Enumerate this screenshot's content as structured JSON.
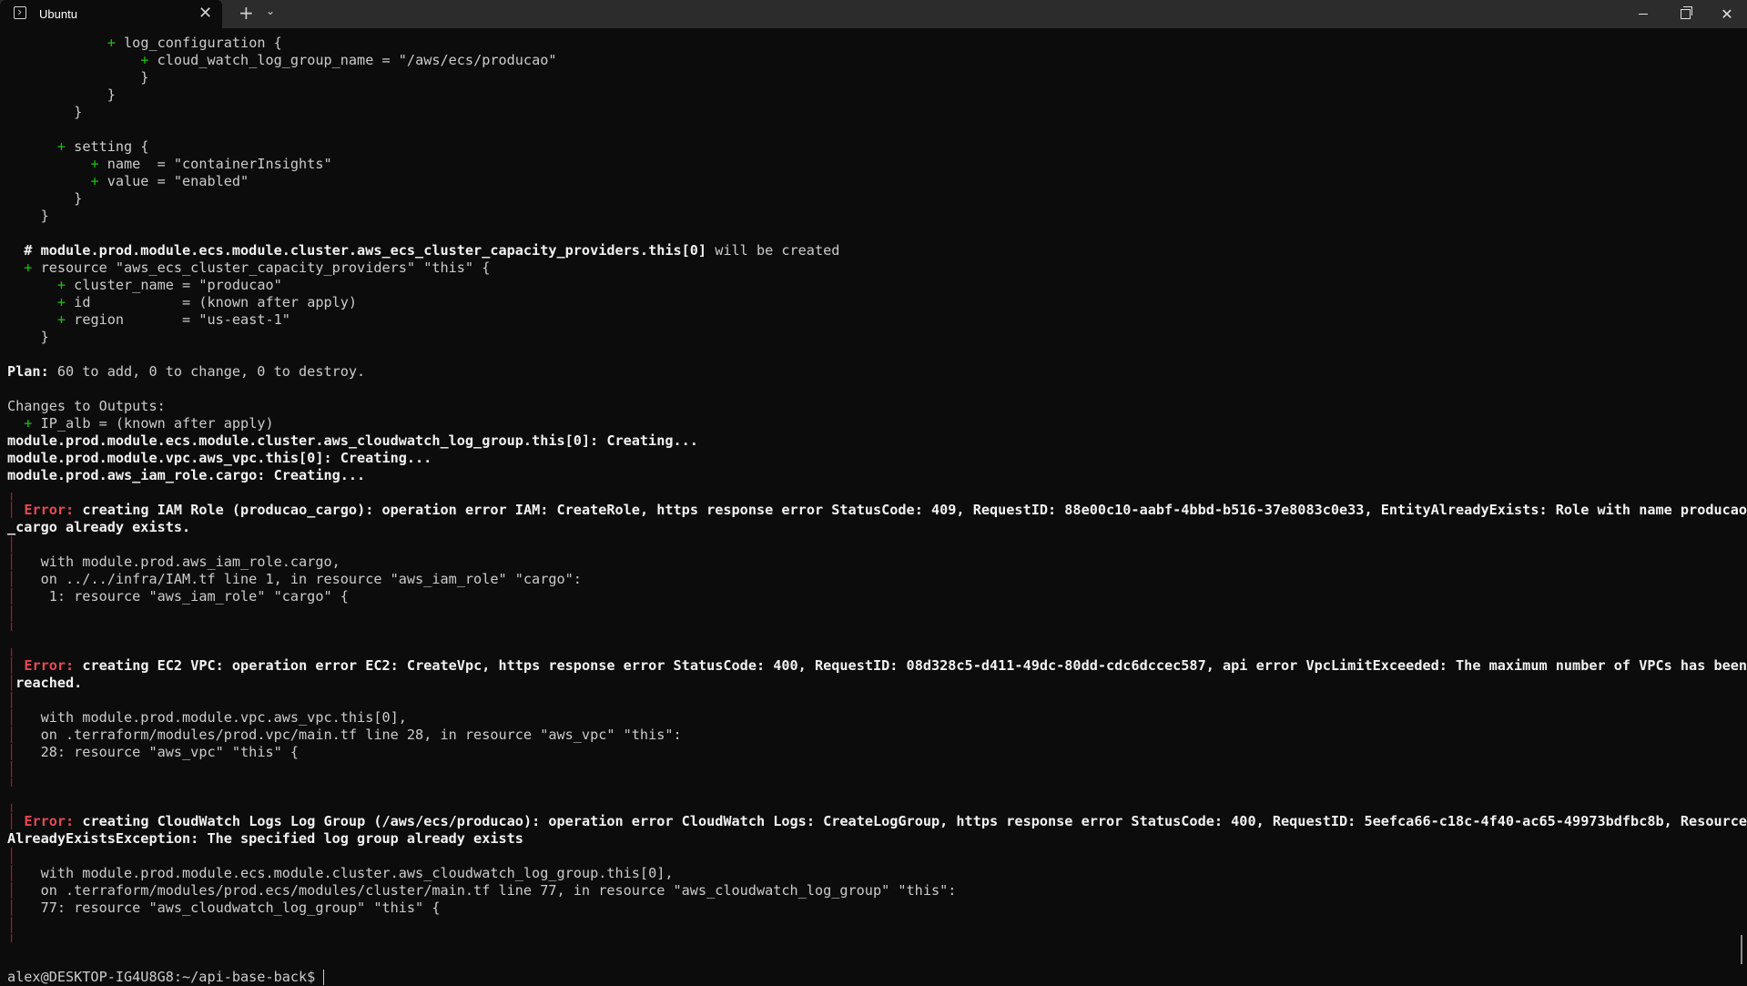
{
  "window": {
    "tab_title": "Ubuntu",
    "tab_close": "✕",
    "new_tab": "+",
    "dropdown": "⌄",
    "close": "✕"
  },
  "terminal": {
    "lines": [
      {
        "segments": [
          {
            "t": "            "
          },
          {
            "t": "+",
            "c": "plus"
          },
          {
            "t": " log_configuration {"
          }
        ]
      },
      {
        "segments": [
          {
            "t": "                "
          },
          {
            "t": "+",
            "c": "plus"
          },
          {
            "t": " cloud_watch_log_group_name = \"/aws/ecs/producao\""
          }
        ]
      },
      {
        "segments": [
          {
            "t": "                }"
          }
        ]
      },
      {
        "segments": [
          {
            "t": "            }"
          }
        ]
      },
      {
        "segments": [
          {
            "t": "        }"
          }
        ]
      },
      {
        "segments": [
          {
            "t": ""
          }
        ]
      },
      {
        "segments": [
          {
            "t": "      "
          },
          {
            "t": "+",
            "c": "plus"
          },
          {
            "t": " setting {"
          }
        ]
      },
      {
        "segments": [
          {
            "t": "          "
          },
          {
            "t": "+",
            "c": "plus"
          },
          {
            "t": " name  = \"containerInsights\""
          }
        ]
      },
      {
        "segments": [
          {
            "t": "          "
          },
          {
            "t": "+",
            "c": "plus"
          },
          {
            "t": " value = \"enabled\""
          }
        ]
      },
      {
        "segments": [
          {
            "t": "        }"
          }
        ]
      },
      {
        "segments": [
          {
            "t": "    }"
          }
        ]
      },
      {
        "segments": [
          {
            "t": ""
          }
        ]
      },
      {
        "segments": [
          {
            "t": "  "
          },
          {
            "t": "# module.prod.module.ecs.module.cluster.aws_ecs_cluster_capacity_providers.this[0]",
            "c": "bold"
          },
          {
            "t": " will be created"
          }
        ]
      },
      {
        "segments": [
          {
            "t": "  "
          },
          {
            "t": "+",
            "c": "plus"
          },
          {
            "t": " resource \"aws_ecs_cluster_capacity_providers\" \"this\" {"
          }
        ]
      },
      {
        "segments": [
          {
            "t": "      "
          },
          {
            "t": "+",
            "c": "plus"
          },
          {
            "t": " cluster_name = \"producao\""
          }
        ]
      },
      {
        "segments": [
          {
            "t": "      "
          },
          {
            "t": "+",
            "c": "plus"
          },
          {
            "t": " id           = (known after apply)"
          }
        ]
      },
      {
        "segments": [
          {
            "t": "      "
          },
          {
            "t": "+",
            "c": "plus"
          },
          {
            "t": " region       = \"us-east-1\""
          }
        ]
      },
      {
        "segments": [
          {
            "t": "    }"
          }
        ]
      },
      {
        "segments": [
          {
            "t": ""
          }
        ]
      },
      {
        "segments": [
          {
            "t": "Plan:",
            "c": "bold"
          },
          {
            "t": " 60 to add, 0 to change, 0 to destroy."
          }
        ]
      },
      {
        "segments": [
          {
            "t": ""
          }
        ]
      },
      {
        "segments": [
          {
            "t": "Changes to Outputs:"
          }
        ]
      },
      {
        "segments": [
          {
            "t": "  "
          },
          {
            "t": "+",
            "c": "plus"
          },
          {
            "t": " IP_alb = (known after apply)"
          }
        ]
      },
      {
        "segments": [
          {
            "t": "module.prod.module.ecs.module.cluster.aws_cloudwatch_log_group.this[0]: Creating...",
            "c": "bold"
          }
        ]
      },
      {
        "segments": [
          {
            "t": "module.prod.module.vpc.aws_vpc.this[0]: Creating...",
            "c": "bold"
          }
        ]
      },
      {
        "segments": [
          {
            "t": "module.prod.aws_iam_role.cargo: Creating...",
            "c": "bold"
          }
        ]
      },
      {
        "segments": [
          {
            "t": "╷",
            "c": "err-bar"
          }
        ]
      },
      {
        "segments": [
          {
            "t": "│",
            "c": "err-bar"
          },
          {
            "t": " "
          },
          {
            "t": "Error:",
            "c": "err-label"
          },
          {
            "t": " creating IAM Role (producao_cargo): operation error IAM: CreateRole, https response error StatusCode: 409, RequestID: 88e00c10-aabf-4bbd-b516-37e8083c0e33, EntityAlreadyExists: Role with name producao",
            "c": "bold"
          }
        ]
      },
      {
        "segments": [
          {
            "t": "_cargo already exists.",
            "c": "bold"
          }
        ]
      },
      {
        "segments": [
          {
            "t": "│",
            "c": "err-bar"
          }
        ]
      },
      {
        "segments": [
          {
            "t": "│",
            "c": "err-bar"
          },
          {
            "t": "   with module.prod.aws_iam_role.cargo,"
          }
        ]
      },
      {
        "segments": [
          {
            "t": "│",
            "c": "err-bar"
          },
          {
            "t": "   on ../../infra/IAM.tf line 1, in resource \"aws_iam_role\" \"cargo\":"
          }
        ]
      },
      {
        "segments": [
          {
            "t": "│",
            "c": "err-bar"
          },
          {
            "t": "    1: resource \"aws_iam_role\" \"cargo\" {"
          }
        ]
      },
      {
        "segments": [
          {
            "t": "│",
            "c": "err-bar"
          }
        ]
      },
      {
        "segments": [
          {
            "t": "╵",
            "c": "err-bar"
          }
        ]
      },
      {
        "segments": [
          {
            "t": "╷",
            "c": "err-bar"
          }
        ]
      },
      {
        "segments": [
          {
            "t": "│",
            "c": "err-bar"
          },
          {
            "t": " "
          },
          {
            "t": "Error:",
            "c": "err-label"
          },
          {
            "t": " creating EC2 VPC: operation error EC2: CreateVpc, https response error StatusCode: 400, RequestID: 08d328c5-d411-49dc-80dd-cdc6dccec587, api error VpcLimitExceeded: The maximum number of VPCs has been",
            "c": "bold"
          }
        ]
      },
      {
        "segments": [
          {
            "t": "│",
            "c": "err-bar"
          },
          {
            "t": "reached.",
            "c": "bold"
          }
        ]
      },
      {
        "segments": [
          {
            "t": "│",
            "c": "err-bar"
          }
        ]
      },
      {
        "segments": [
          {
            "t": "│",
            "c": "err-bar"
          },
          {
            "t": "   with module.prod.module.vpc.aws_vpc.this[0],"
          }
        ]
      },
      {
        "segments": [
          {
            "t": "│",
            "c": "err-bar"
          },
          {
            "t": "   on .terraform/modules/prod.vpc/main.tf line 28, in resource \"aws_vpc\" \"this\":"
          }
        ]
      },
      {
        "segments": [
          {
            "t": "│",
            "c": "err-bar"
          },
          {
            "t": "   28: resource \"aws_vpc\" \"this\" {"
          }
        ]
      },
      {
        "segments": [
          {
            "t": "│",
            "c": "err-bar"
          }
        ]
      },
      {
        "segments": [
          {
            "t": "╵",
            "c": "err-bar"
          }
        ]
      },
      {
        "segments": [
          {
            "t": "╷",
            "c": "err-bar"
          }
        ]
      },
      {
        "segments": [
          {
            "t": "│",
            "c": "err-bar"
          },
          {
            "t": " "
          },
          {
            "t": "Error:",
            "c": "err-label"
          },
          {
            "t": " creating CloudWatch Logs Log Group (/aws/ecs/producao): operation error CloudWatch Logs: CreateLogGroup, https response error StatusCode: 400, RequestID: 5eefca66-c18c-4f40-ac65-49973bdfbc8b, Resource",
            "c": "bold"
          }
        ]
      },
      {
        "segments": [
          {
            "t": "AlreadyExistsException: The specified log group already exists",
            "c": "bold"
          }
        ]
      },
      {
        "segments": [
          {
            "t": "│",
            "c": "err-bar"
          }
        ]
      },
      {
        "segments": [
          {
            "t": "│",
            "c": "err-bar"
          },
          {
            "t": "   with module.prod.module.ecs.module.cluster.aws_cloudwatch_log_group.this[0],"
          }
        ]
      },
      {
        "segments": [
          {
            "t": "│",
            "c": "err-bar"
          },
          {
            "t": "   on .terraform/modules/prod.ecs/modules/cluster/main.tf line 77, in resource \"aws_cloudwatch_log_group\" \"this\":"
          }
        ]
      },
      {
        "segments": [
          {
            "t": "│",
            "c": "err-bar"
          },
          {
            "t": "   77: resource \"aws_cloudwatch_log_group\" \"this\" {"
          }
        ]
      },
      {
        "segments": [
          {
            "t": "│",
            "c": "err-bar"
          }
        ]
      },
      {
        "segments": [
          {
            "t": "╵",
            "c": "err-bar"
          }
        ]
      }
    ],
    "prompt": "alex@DESKTOP-IG4U8G8:~/api-base-back$ "
  }
}
